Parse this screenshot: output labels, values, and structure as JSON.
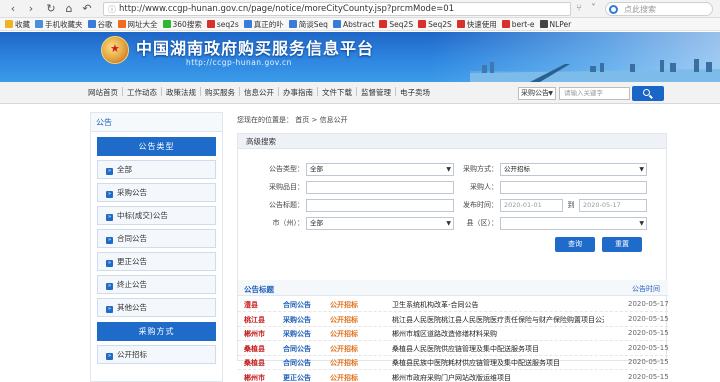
{
  "browser": {
    "url": "http://www.ccgp-hunan.gov.cn/page/notice/moreCityCounty.jsp?prcmMode=01",
    "search_placeholder": "点此搜索",
    "favorites": [
      {
        "label": "收藏",
        "color": "#f0b323"
      },
      {
        "label": "手机收藏夹",
        "color": "#4a90d9"
      },
      {
        "label": "谷歌",
        "color": "#3a7bd5"
      },
      {
        "label": "网址大全",
        "color": "#f36b21"
      },
      {
        "label": "360搜索",
        "color": "#2eb82e"
      },
      {
        "label": "seq2s",
        "color": "#d9302c"
      },
      {
        "label": "真正的卟",
        "color": "#3a7bd5"
      },
      {
        "label": "简谈Seq",
        "color": "#3a7bd5"
      },
      {
        "label": "Abstract",
        "color": "#3a7bd5"
      },
      {
        "label": "Seq2S",
        "color": "#d9302c"
      },
      {
        "label": "Seq2S",
        "color": "#d9302c"
      },
      {
        "label": "快速使用",
        "color": "#d9302c"
      },
      {
        "label": "bert-e",
        "color": "#d9302c"
      },
      {
        "label": "NLPer",
        "color": "#444444"
      }
    ]
  },
  "site": {
    "title": "中国湖南政府购买服务信息平台",
    "url": "http://ccgp-hunan.gov.cn"
  },
  "nav": {
    "items": [
      "网站首页",
      "工作动态",
      "政策法规",
      "购买服务",
      "信息公开",
      "办事指南",
      "文件下载",
      "监督管理",
      "电子卖场"
    ],
    "search_select": "采购公告",
    "search_placeholder": "请输入关键字"
  },
  "sidebar": {
    "header": "公告",
    "category1": "公告类型",
    "items1": [
      "全部",
      "采购公告",
      "中标(成交)公告",
      "合同公告",
      "更正公告",
      "终止公告",
      "其他公告"
    ],
    "category2": "采购方式",
    "items2": [
      "公开招标"
    ]
  },
  "main": {
    "breadcrumb_prefix": "您现在的位置是：",
    "breadcrumb_home": "首页",
    "breadcrumb_sep": ">",
    "breadcrumb_current": "信息公开",
    "adv_title": "高级搜索",
    "form": {
      "type_label": "公告类型：",
      "type_value": "全部",
      "method_label": "采购方式：",
      "method_value": "公开招标",
      "item_label": "采购品目：",
      "buyer_label": "采购人：",
      "notice_title_label": "公告标题：",
      "publish_time_label": "发布时间：",
      "date_from": "2020-01-01",
      "date_to_label": "到",
      "date_to": "2020-05-17",
      "city_label": "市（州）：",
      "city_value": "全部",
      "county_label": "县（区）：",
      "county_value": ""
    },
    "query_button": "查询",
    "reset_button": "重置",
    "list_title": "公告标题",
    "list_time": "公告时间",
    "rows": [
      {
        "region": "澧县",
        "type": "合同公告",
        "method": "公开招标",
        "title": "卫生系统机构改革-合同公告",
        "date": "2020-05-17"
      },
      {
        "region": "桃江县",
        "type": "采购公告",
        "method": "公开招标",
        "title": "桃江县人民医院桃江县人民医院医疗责任保险与财产保险购置项目公开...",
        "date": "2020-05-15"
      },
      {
        "region": "郴州市",
        "type": "采购公告",
        "method": "公开招标",
        "title": "郴州市城区道路改造修缮材料采购",
        "date": "2020-05-15"
      },
      {
        "region": "桑植县",
        "type": "合同公告",
        "method": "公开招标",
        "title": "桑植县人民医院供应链管理及集中配送服务项目",
        "date": "2020-05-15"
      },
      {
        "region": "桑植县",
        "type": "合同公告",
        "method": "公开招标",
        "title": "桑植县民族中医院耗材供应链管理及集中配送服务项目",
        "date": "2020-05-15"
      },
      {
        "region": "郴州市",
        "type": "更正公告",
        "method": "公开招标",
        "title": "郴州市政府采购门户网站改版运维项目",
        "date": "2020-05-15"
      }
    ]
  }
}
